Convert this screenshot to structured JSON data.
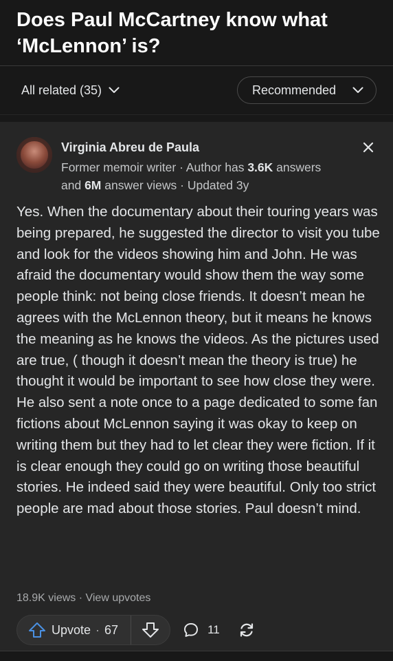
{
  "question": {
    "title": "Does Paul McCartney know what ‘McLennon’ is?"
  },
  "filters": {
    "all_related_label": "All related (35)",
    "sort_label": "Recommended"
  },
  "answer": {
    "author": {
      "name": "Virginia Abreu de Paula",
      "credential_prefix": "Former memoir writer · Author has ",
      "answers_count": "3.6K",
      "answers_suffix": " answers",
      "and_label": "and ",
      "views_count": "6M",
      "views_suffix": " answer views · Updated 3y"
    },
    "body": "Yes. When the documentary about their touring years was being prepared, he suggested the director to visit you tube and look for the videos showing him and John. He was afraid the documentary would show them the way some people think: not being close friends. It doesn’t mean he agrees with the McLennon theory, but it means he knows the meaning as he knows the videos. As the pictures used are true, ( though it doesn’t mean the theory is true) he thought it would be important to see how close they were. He also sent a note once to a page dedicated to some fan fictions about McLennon saying it was okay to keep on writing them but they had to let clear they were fiction. If it is clear enough they could go on writing those beautiful stories. He indeed said they were beautiful. Only too strict people are mad about those stories. Paul doesn’t mind.",
    "stats": {
      "views": "18.9K views",
      "separator": " · ",
      "view_upvotes": "View upvotes"
    },
    "actions": {
      "upvote_label": "Upvote",
      "upvote_count": "67",
      "comment_count": "11"
    }
  },
  "colors": {
    "background": "#181818",
    "card": "#262626",
    "upvote_accent": "#4a90e2"
  }
}
